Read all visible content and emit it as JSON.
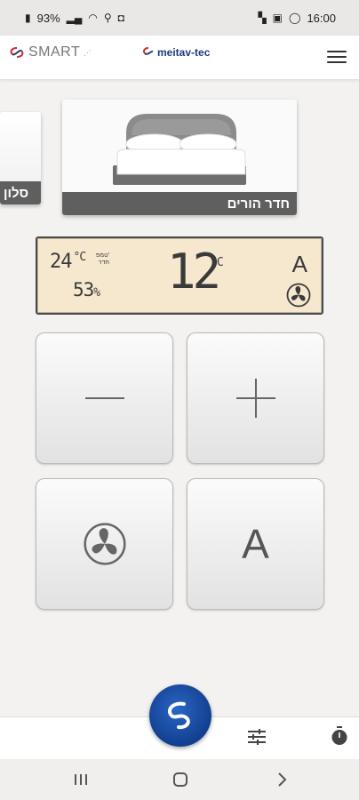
{
  "status_bar": {
    "battery": "93%",
    "time": "16:00"
  },
  "header": {
    "brand_smart": "SMART",
    "brand_mt": "meitav-tec"
  },
  "rooms": [
    {
      "label": "חדר הורים"
    },
    {
      "label": "סלון"
    }
  ],
  "lcd": {
    "room_temp": "24",
    "room_temp_unit": "°C",
    "room_label_line1": "טמפ'",
    "room_label_line2": "חדר",
    "humidity": "53",
    "humidity_unit": "%",
    "setpoint": "12",
    "setpoint_unit": "°C",
    "mode": "A"
  },
  "controls": {
    "mode_label": "A"
  },
  "colors": {
    "lcd_bg": "#f6e8cf",
    "fab": "#1a4fa3",
    "brand_red": "#d12a2a",
    "brand_blue": "#1d3b7a"
  },
  "icons": [
    "menu-icon",
    "fan-icon",
    "minus-icon",
    "plus-icon",
    "tune-icon",
    "timer-icon",
    "logo-swirl-icon"
  ]
}
